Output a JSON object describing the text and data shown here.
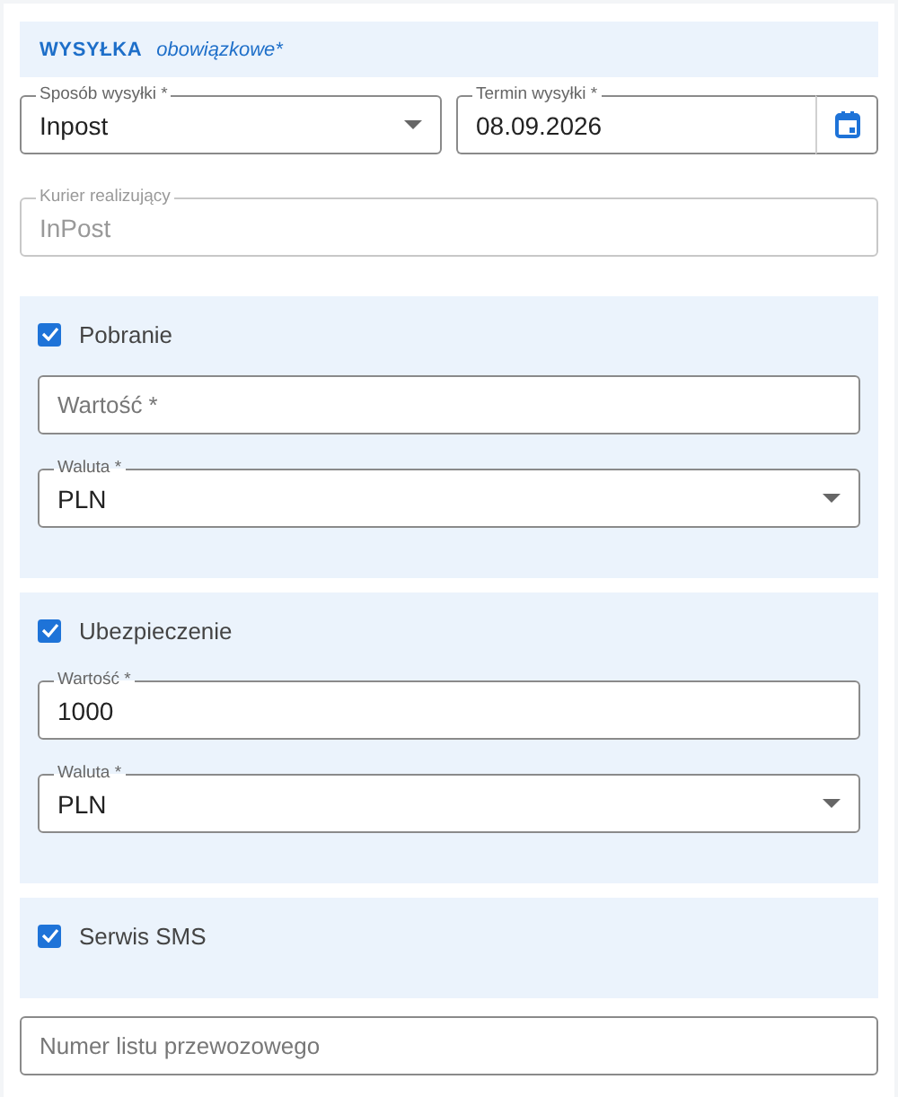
{
  "section": {
    "title": "WYSYŁKA",
    "note": "obowiązkowe*"
  },
  "shipping_method": {
    "label": "Sposób wysyłki *",
    "value": "Inpost"
  },
  "shipping_date": {
    "label": "Termin wysyłki *",
    "value": "08.09.2026"
  },
  "courier": {
    "label": "Kurier realizujący",
    "value": "InPost",
    "disabled": true
  },
  "options": [
    {
      "label": "Pobranie",
      "checked": true,
      "fields": [
        {
          "kind": "text",
          "placeholder": "Wartość *"
        },
        {
          "kind": "select",
          "label": "Waluta *",
          "value": "PLN"
        }
      ]
    },
    {
      "label": "Ubezpieczenie",
      "checked": true,
      "fields": [
        {
          "kind": "text",
          "label": "Wartość *",
          "value": "1000"
        },
        {
          "kind": "select",
          "label": "Waluta *",
          "value": "PLN"
        }
      ]
    },
    {
      "label": "Serwis SMS",
      "checked": true
    }
  ],
  "waybill": {
    "placeholder": "Numer listu przewozowego"
  }
}
